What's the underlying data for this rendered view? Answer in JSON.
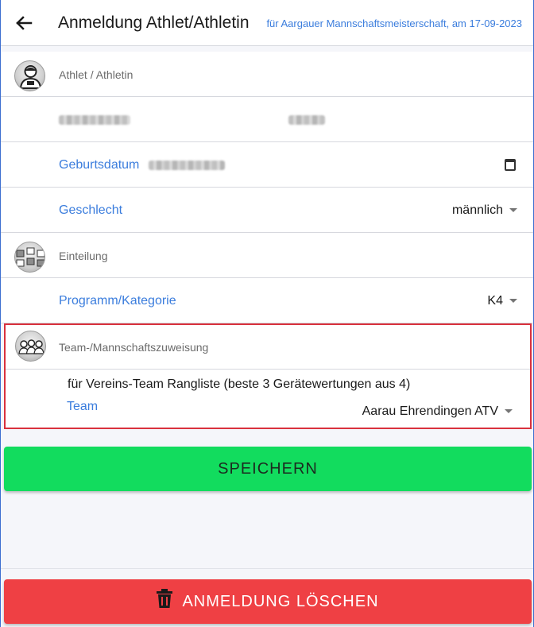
{
  "toolbar": {
    "title": "Anmeldung Athlet/Athletin",
    "subtitle": "für Aargauer Mannschaftsmeisterschaft, am 17-09-2023",
    "back_icon": "arrow-left-icon"
  },
  "athlete": {
    "section_label": "Athlet / Athletin",
    "icon": "athlete-avatar-icon"
  },
  "birthdate": {
    "label": "Geburtsdatum",
    "icon": "calendar-icon"
  },
  "gender": {
    "label": "Geschlecht",
    "value": "männlich"
  },
  "division": {
    "section_label": "Einteilung",
    "icon": "apparatus-avatar-icon"
  },
  "program": {
    "label": "Programm/Kategorie",
    "value": "K4"
  },
  "team": {
    "section_label": "Team-/Mannschaftszuweisung",
    "icon": "team-avatar-icon",
    "description": "für Vereins-Team Rangliste (beste 3 Gerätewertungen aus 4)",
    "label": "Team",
    "value": "Aarau Ehrendingen ATV"
  },
  "actions": {
    "save_label": "SPEICHERN",
    "delete_label": "ANMELDUNG LÖSCHEN",
    "delete_icon": "trash-icon"
  },
  "colors": {
    "accent": "#3b7ddd",
    "save": "#12dc5e",
    "delete": "#ef4044",
    "highlight": "#d9313d"
  }
}
